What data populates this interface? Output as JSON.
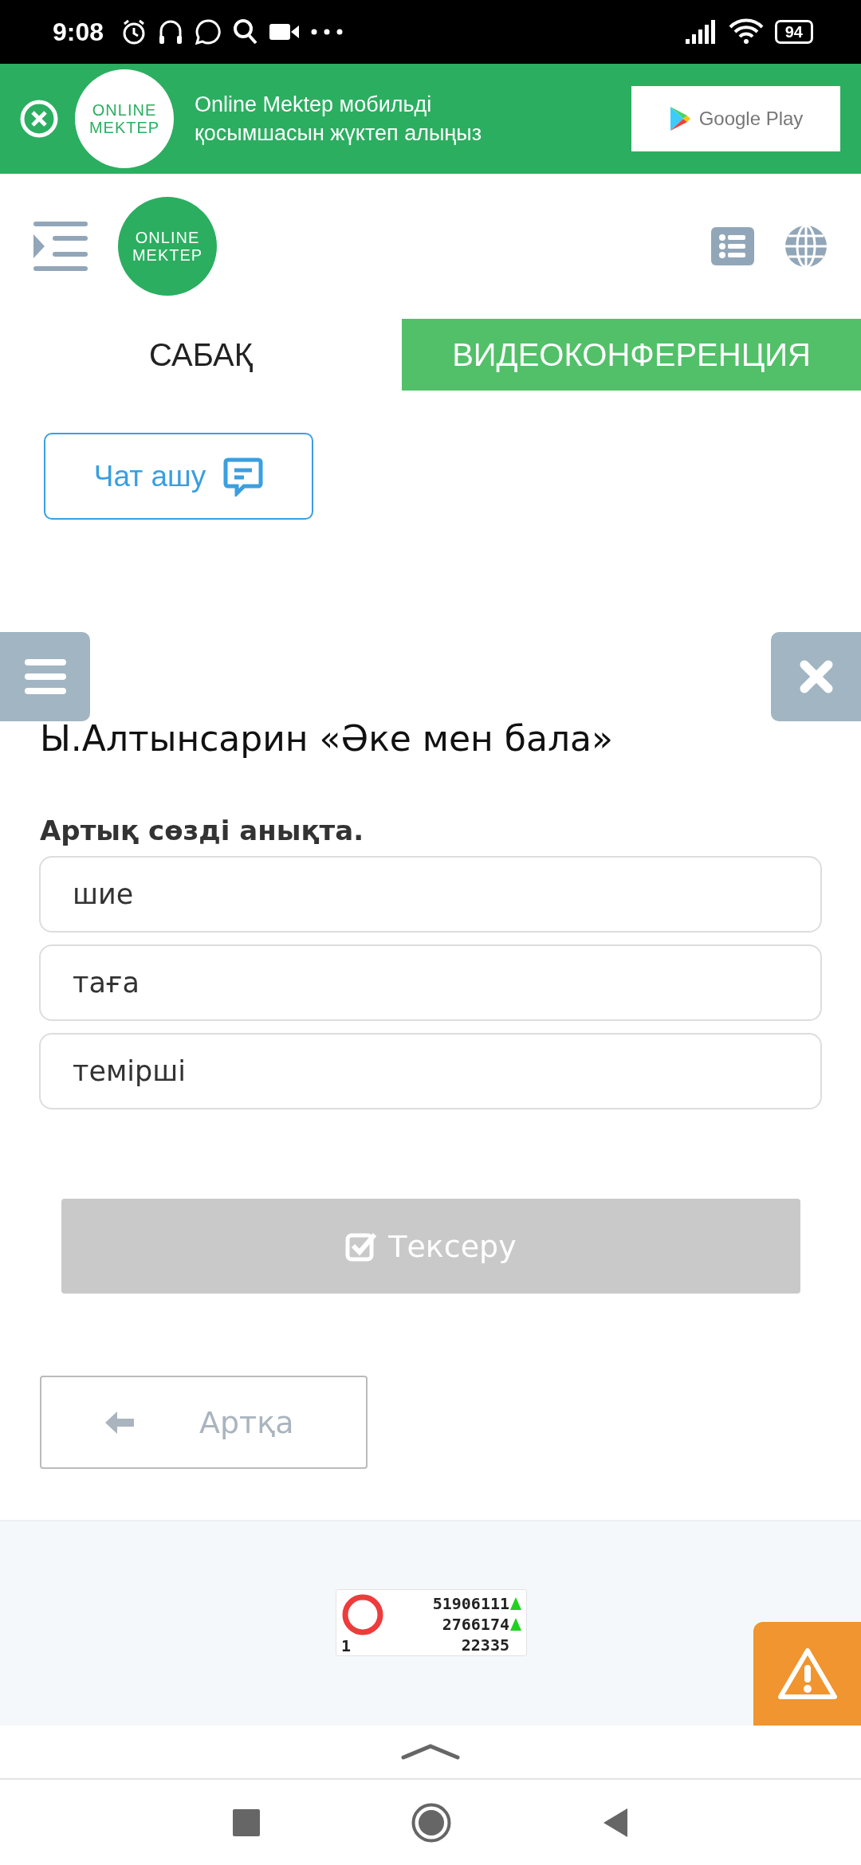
{
  "status_bar": {
    "time": "9:08",
    "battery": "94"
  },
  "app_banner": {
    "logo": [
      "ONLINE",
      "MEKTEP"
    ],
    "text": "Online Mektep мобильді қосымшасын жүктеп алыңыз",
    "store_button": "Google Play"
  },
  "header": {
    "logo": [
      "ONLINE",
      "MEKTEP"
    ]
  },
  "tabs": [
    {
      "label": "САБАҚ",
      "selected": false
    },
    {
      "label": "ВИДЕОКОНФЕРЕНЦИЯ",
      "selected": true
    }
  ],
  "chat_button": "Чат ашу",
  "lesson_title": "Ы.Алтынсарин «Әке мен бала»",
  "question": "Артық сөзді анықта.",
  "options": [
    {
      "label": "шие",
      "selected": false
    },
    {
      "label": "таға",
      "selected": false
    },
    {
      "label": "темірші",
      "selected": false
    }
  ],
  "check_button": {
    "label": "Тексеру",
    "disabled": true
  },
  "back_button": "Артқа",
  "counter": {
    "values": [
      "51906111",
      "2766174",
      "22335"
    ],
    "rising": [
      true,
      true,
      false
    ],
    "corner": "1"
  }
}
